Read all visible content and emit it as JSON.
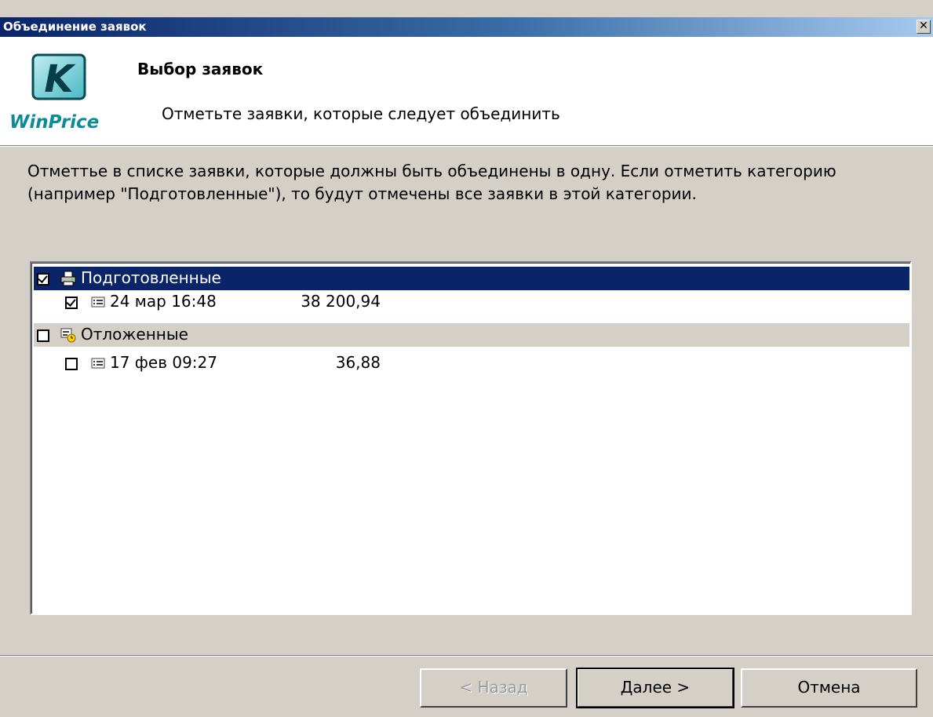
{
  "window": {
    "title": "Объединение заявок",
    "close_glyph": "✕"
  },
  "header": {
    "logo_text": "WinPrice",
    "logo_letter": "K",
    "step_title": "Выбор заявок",
    "step_subtitle": "Отметьте заявки, которые следует объединить"
  },
  "description": "Отметтье в списке заявки, которые должны быть объединены в одну. Если отметить категорию (например \"Подготовленные\"), то будут отмечены все заявки в этой категории.",
  "tree": [
    {
      "type": "category",
      "label": "Подготовленные",
      "checked": true,
      "selected": true,
      "icon": "printer-icon"
    },
    {
      "type": "item",
      "label": "24 мар 16:48",
      "amount": "38 200,94",
      "checked": true,
      "icon": "document-list-icon"
    },
    {
      "type": "category",
      "label": "Отложенные",
      "checked": false,
      "selected": false,
      "icon": "deferred-clock-icon"
    },
    {
      "type": "item",
      "label": "17 фев 09:27",
      "amount": "36,88",
      "checked": false,
      "icon": "document-list-icon"
    }
  ],
  "buttons": {
    "back": "< Назад",
    "next": "Далее >",
    "cancel": "Отмена"
  },
  "colors": {
    "selection": "#0a246a",
    "dialog_face": "#d4d0c8",
    "logo_teal": "#0d8c95"
  }
}
